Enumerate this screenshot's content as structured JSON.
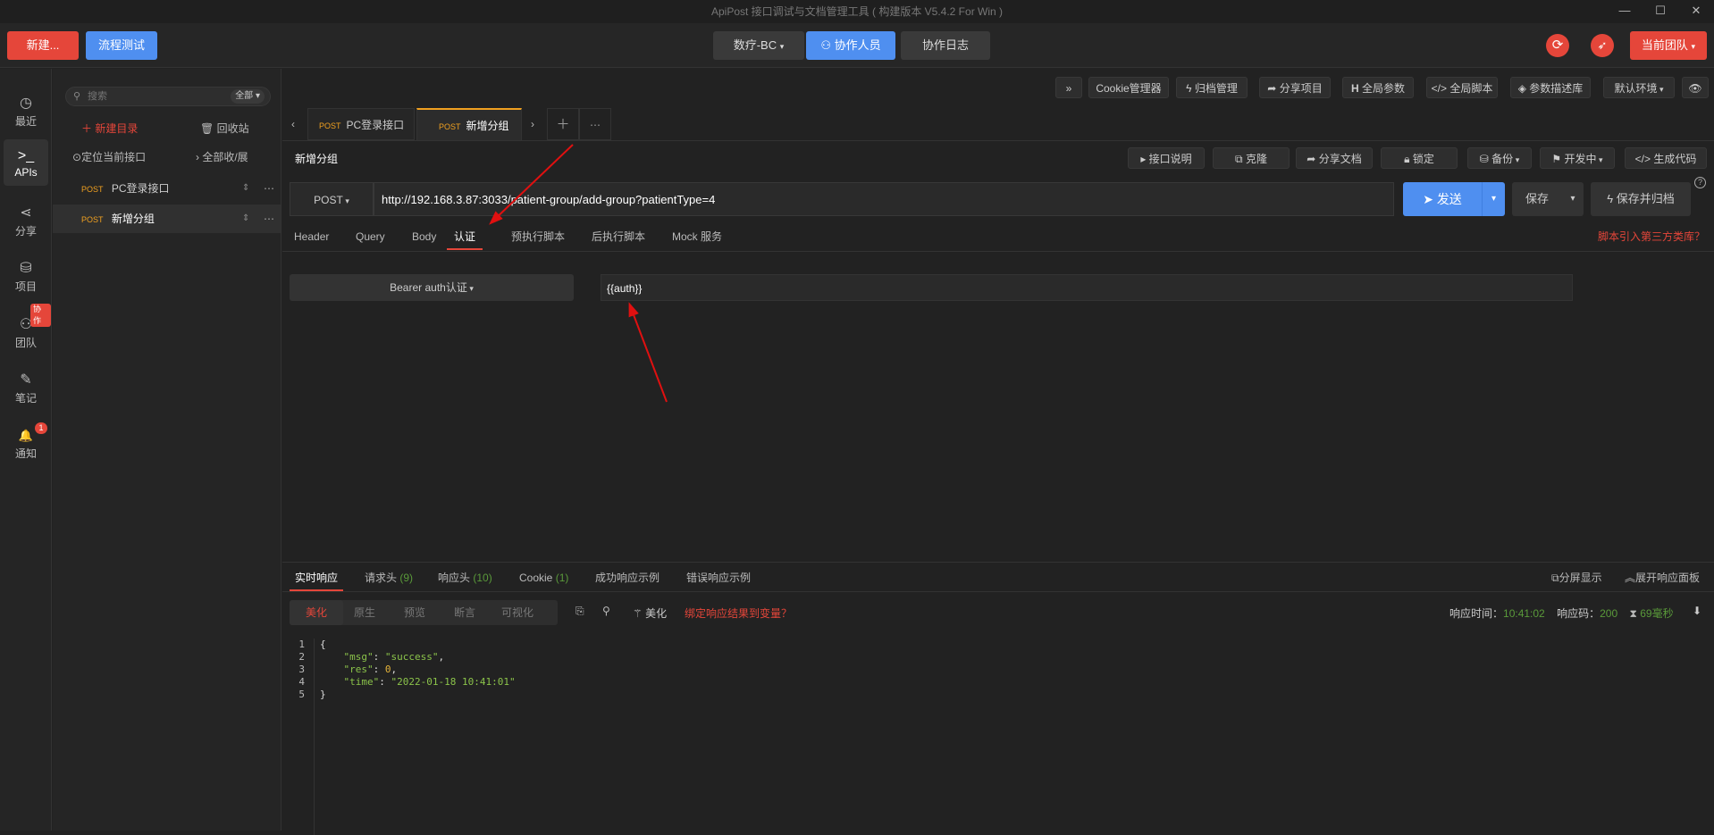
{
  "window": {
    "title": "ApiPost 接口调试与文档管理工具 ( 构建版本 V5.4.2 For Win )",
    "min": "—",
    "max": "☐",
    "close": "✕"
  },
  "topbar": {
    "new_label": "新建...",
    "flow_label": "流程测试",
    "project_label": "数疗-BC",
    "members_label": "协作人员",
    "log_label": "协作日志",
    "team_label": "当前团队"
  },
  "leftnav": [
    {
      "label": "最近",
      "icon": "◷"
    },
    {
      "label": "APIs",
      "icon": ">_"
    },
    {
      "label": "分享",
      "icon": "⋖"
    },
    {
      "label": "项目",
      "icon": "⛁"
    },
    {
      "label": "团队",
      "icon": "⚇",
      "badge": "协作"
    },
    {
      "label": "笔记",
      "icon": "✎"
    },
    {
      "label": "通知",
      "icon": "🔔",
      "badge": "1"
    }
  ],
  "sidebar": {
    "search_placeholder": "搜索",
    "filter": "全部",
    "new_dir": "新建目录",
    "recycle": "回收站",
    "locate": "定位当前接口",
    "collapse": "全部收/展",
    "items": [
      {
        "method": "POST",
        "name": "PC登录接口"
      },
      {
        "method": "POST",
        "name": "新增分组"
      }
    ]
  },
  "toolbar": {
    "expand": "»",
    "cookie": "Cookie管理器",
    "archive": "归档管理",
    "share": "分享项目",
    "global_params": "全局参数",
    "global_script": "全局脚本",
    "param_lib": "参数描述库",
    "env": "默认环境",
    "eye": "👁"
  },
  "tabs": [
    {
      "method": "POST",
      "name": "PC登录接口"
    },
    {
      "method": "POST",
      "name": "新增分组"
    }
  ],
  "request": {
    "title": "新增分组",
    "actions": {
      "doc": "接口说明",
      "clone": "克隆",
      "share_doc": "分享文档",
      "lock": "锁定",
      "backup": "备份",
      "status": "开发中",
      "gen_code": "生成代码"
    },
    "method": "POST",
    "url": "http://192.168.3.87:3033/patient-group/add-group?patientType=4",
    "send": "发送",
    "save": "保存",
    "save_archive": "保存并归档",
    "subtabs": [
      "Header",
      "Query",
      "Body",
      "认证",
      "预执行脚本",
      "后执行脚本",
      "Mock 服务"
    ],
    "script_link": "脚本引入第三方类库？",
    "auth_type": "Bearer auth认证",
    "auth_value": "{{auth}}"
  },
  "response": {
    "tabs": [
      {
        "label": "实时响应",
        "count": ""
      },
      {
        "label": "请求头",
        "count": "(9)"
      },
      {
        "label": "响应头",
        "count": "(10)"
      },
      {
        "label": "Cookie",
        "count": "(1)"
      },
      {
        "label": "成功响应示例",
        "count": ""
      },
      {
        "label": "错误响应示例",
        "count": ""
      }
    ],
    "split": "分屏显示",
    "expand": "展开响应面板",
    "views": [
      "美化",
      "原生",
      "预览",
      "断言",
      "可视化"
    ],
    "beautify": "美化",
    "bind_var": "绑定响应结果到变量？",
    "time_label": "响应时间：",
    "time_value": "10:41:02",
    "code_label": "响应码：",
    "code_value": "200",
    "duration": "69毫秒",
    "lines": [
      "1",
      "2",
      "3",
      "4",
      "5"
    ]
  }
}
